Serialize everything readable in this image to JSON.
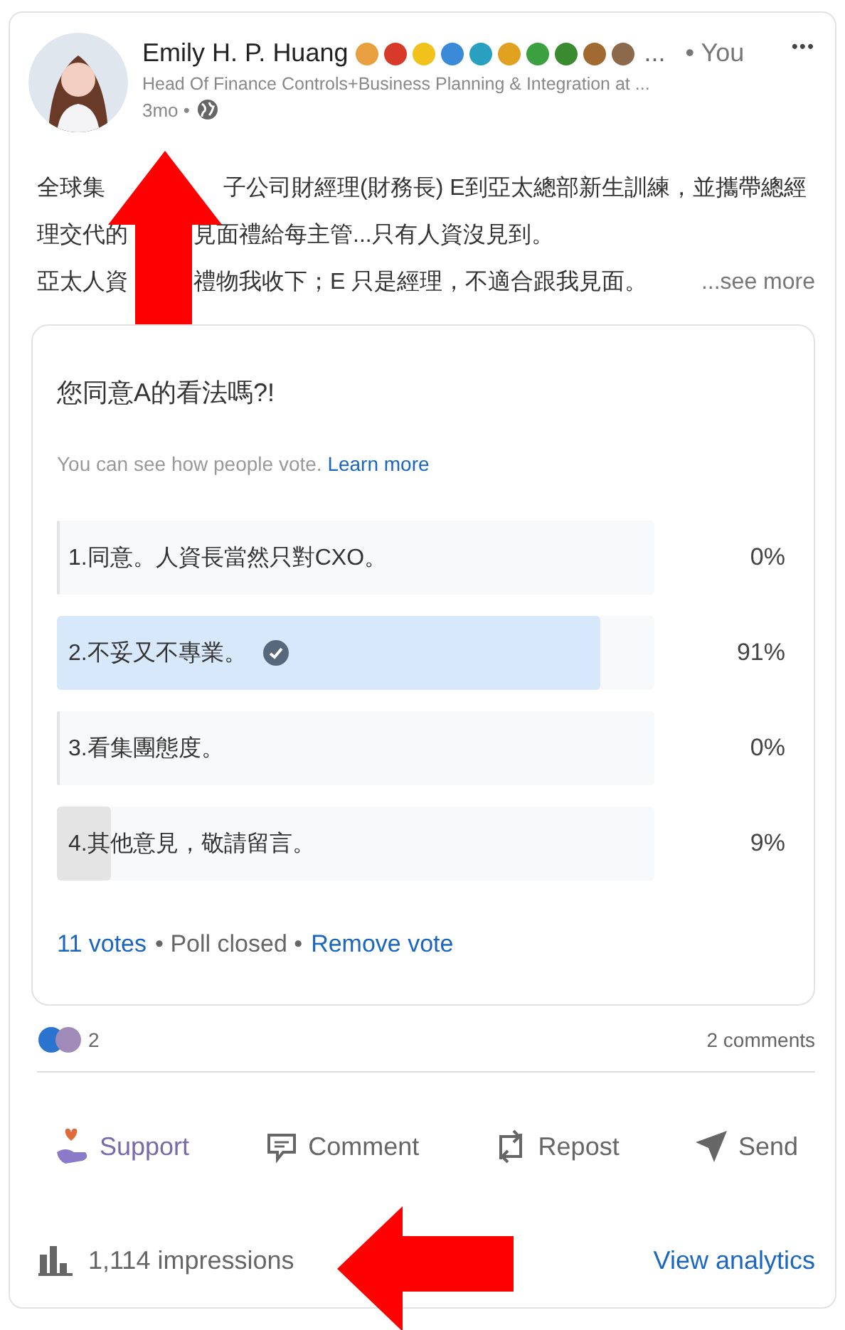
{
  "post": {
    "author": "Emily H. P. Huang",
    "name_overflow": "...",
    "relation": "• You",
    "headline": "Head Of Finance Controls+Business Planning & Integration at ...",
    "time": "3mo •",
    "more_menu": "•••",
    "body_lines": [
      [
        "全球集",
        "子公司財經理(財務長) E到亞太總部新生訓練，並攜帶總經"
      ],
      [
        "理交代的",
        "見面禮給每主管...只有人資沒見到。"
      ],
      [
        "亞太人資",
        "禮物我收下；E 只是經理，不適合跟我見面。"
      ]
    ],
    "see_more": "...see more"
  },
  "poll": {
    "question": "您同意A的看法嗎?!",
    "note": "You can see how people vote.",
    "learn_more": "Learn more",
    "options": [
      {
        "label": "1.同意。人資長當然只對CXO。",
        "percent": "0%",
        "level": 0,
        "selected": false
      },
      {
        "label": "2.不妥又不專業。",
        "percent": "91%",
        "level": 0.91,
        "selected": true
      },
      {
        "label": "3.看集團態度。",
        "percent": "0%",
        "level": 0,
        "selected": false
      },
      {
        "label": "4.其他意見，敬請留言。",
        "percent": "9%",
        "level": 0.09,
        "selected": false
      }
    ],
    "votes": "11 votes",
    "status": "• Poll closed •",
    "remove_vote": "Remove vote"
  },
  "social": {
    "reaction_count": "2",
    "comments": "2 comments"
  },
  "actions": [
    {
      "kind": "support",
      "label": "Support"
    },
    {
      "kind": "comment",
      "label": "Comment"
    },
    {
      "kind": "repost",
      "label": "Repost"
    },
    {
      "kind": "send",
      "label": "Send"
    }
  ],
  "analytics": {
    "impressions": "1,114 impressions",
    "view": "View analytics"
  }
}
